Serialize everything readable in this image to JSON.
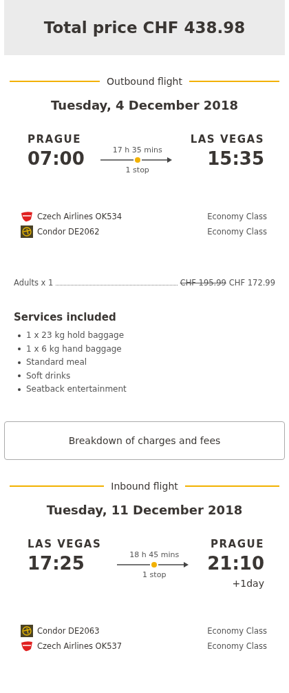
{
  "total": "Total price CHF 438.98",
  "flights": [
    {
      "heading": "Outbound flight",
      "date": "Tuesday, 4 December 2018",
      "from_city": "PRAGUE",
      "from_time": "07:00",
      "duration": "17 h 35 mins",
      "stops": "1 stop",
      "to_city": "LAS VEGAS",
      "to_time": "15:35",
      "segments": [
        {
          "kind": "czech",
          "airline": "Czech Airlines OK534",
          "cabin": "Economy Class"
        },
        {
          "kind": "condor",
          "airline": "Condor DE2062",
          "cabin": "Economy Class"
        }
      ],
      "fare": {
        "label": "Adults x 1",
        "old_price": "CHF 195.99",
        "price": "CHF 172.99"
      },
      "services": {
        "title": "Services included",
        "items": [
          "1 x 23 kg hold baggage",
          "1 x 6 kg hand baggage",
          "Standard meal",
          "Soft drinks",
          "Seatback entertainment"
        ]
      },
      "breakdown": "Breakdown of charges and fees"
    },
    {
      "heading": "Inbound flight",
      "date": "Tuesday, 11 December 2018",
      "from_city": "LAS VEGAS",
      "from_time": "17:25",
      "duration": "18 h 45 mins",
      "stops": "1 stop",
      "to_city": "PRAGUE",
      "to_time": "21:10",
      "day_offset": "+1day",
      "segments": [
        {
          "kind": "condor",
          "airline": "Condor DE2063",
          "cabin": "Economy Class"
        },
        {
          "kind": "czech",
          "airline": "Czech Airlines OK537",
          "cabin": "Economy Class"
        }
      ]
    }
  ]
}
